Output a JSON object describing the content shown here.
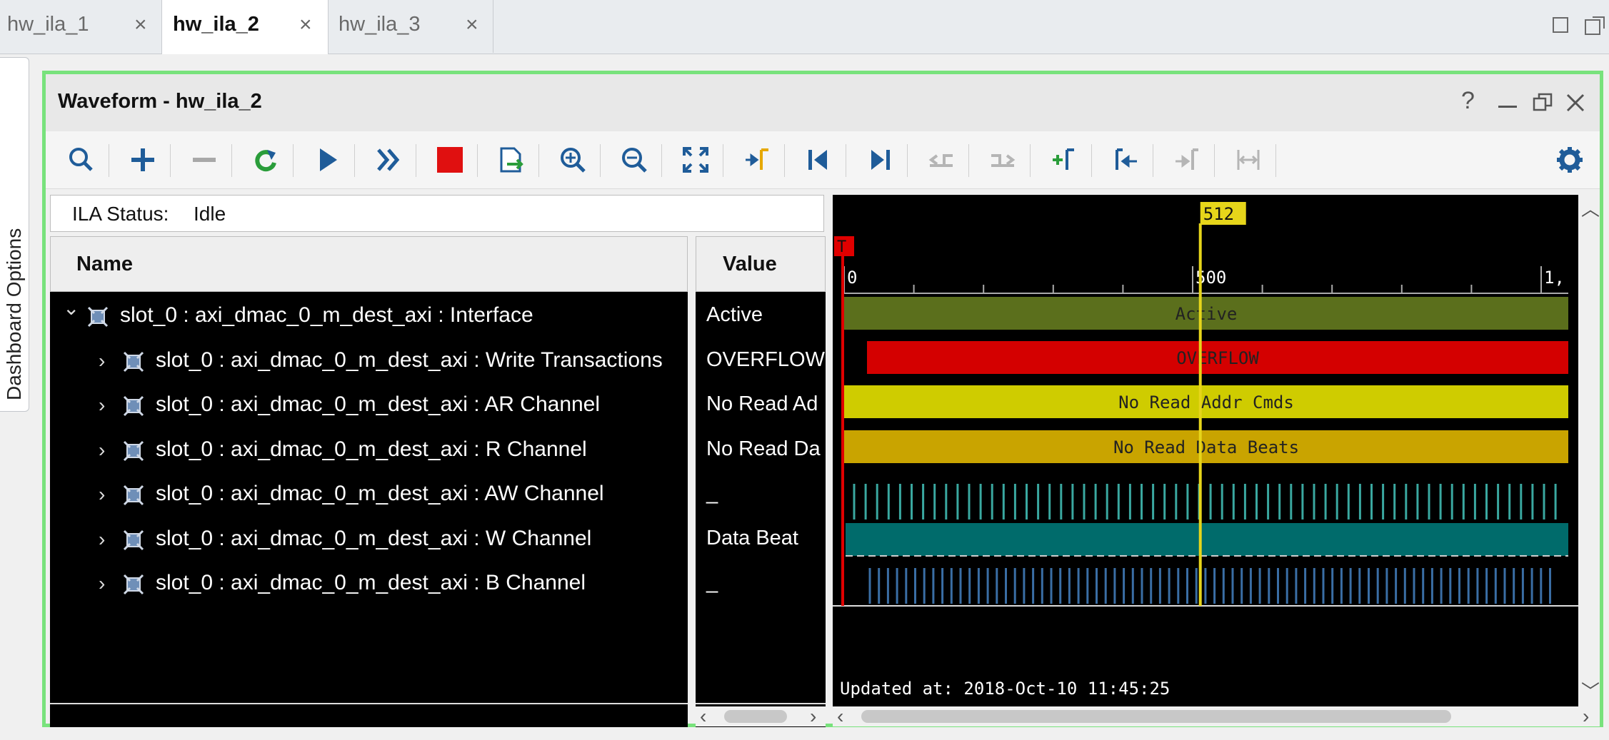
{
  "tabs": [
    {
      "label": "hw_ila_1",
      "active": false
    },
    {
      "label": "hw_ila_2",
      "active": true
    },
    {
      "label": "hw_ila_3",
      "active": false
    }
  ],
  "tab_close_glyph": "×",
  "side_tab": {
    "label": "Dashboard Options"
  },
  "window": {
    "title": "Waveform - hw_ila_2",
    "help_glyph": "?"
  },
  "toolbar": {
    "icons": [
      "search-icon",
      "add-icon",
      "remove-icon",
      "refresh-icon",
      "run-trigger-icon",
      "run-immediate-icon",
      "stop-icon",
      "export-icon",
      "zoom-in-icon",
      "zoom-out-icon",
      "zoom-fit-icon",
      "go-to-cursor-icon",
      "go-to-time-zero-icon",
      "go-to-last-time-icon",
      "previous-transition-icon",
      "next-transition-icon",
      "add-marker-icon",
      "previous-marker-icon",
      "next-marker-icon",
      "swap-cursors-icon",
      "settings-icon"
    ]
  },
  "status": {
    "label": "ILA Status:",
    "value": "Idle"
  },
  "columns": {
    "name": "Name",
    "value": "Value"
  },
  "signals": [
    {
      "name": "slot_0 : axi_dmac_0_m_dest_axi : Interface",
      "value": "Active",
      "expanded": true,
      "level": 0
    },
    {
      "name": "slot_0 : axi_dmac_0_m_dest_axi : Write Transactions",
      "value": "OVERFLOW",
      "expanded": false,
      "level": 1
    },
    {
      "name": "slot_0 : axi_dmac_0_m_dest_axi : AR Channel",
      "value": "No Read Ad",
      "expanded": false,
      "level": 1
    },
    {
      "name": "slot_0 : axi_dmac_0_m_dest_axi : R Channel",
      "value": "No Read Da",
      "expanded": false,
      "level": 1
    },
    {
      "name": "slot_0 : axi_dmac_0_m_dest_axi : AW Channel",
      "value": "_",
      "expanded": false,
      "level": 1
    },
    {
      "name": "slot_0 : axi_dmac_0_m_dest_axi : W Channel",
      "value": "Data Beat",
      "expanded": false,
      "level": 1
    },
    {
      "name": "slot_0 : axi_dmac_0_m_dest_axi : B Channel",
      "value": "_",
      "expanded": false,
      "level": 1
    }
  ],
  "waveform": {
    "cursor_label": "512",
    "trigger_label": "T",
    "ruler_labels": [
      "0",
      "500",
      "1,"
    ],
    "bars": [
      {
        "text": "Active",
        "color": "#5b6f1c"
      },
      {
        "text": "OVERFLOW",
        "color": "#d40000"
      },
      {
        "text": "No Read Addr Cmds",
        "color": "#cfcc00"
      },
      {
        "text": "No Read Data Beats",
        "color": "#c9a400"
      }
    ],
    "aw_color": "#3aa8a0",
    "w_color": "#006b6b",
    "b_color": "#3a6ea5",
    "trigger_color": "#e00000",
    "cursor_color": "#e6d51a",
    "updated": "Updated at: 2018-Oct-10 11:45:25"
  },
  "colors": {
    "panel_border": "#78e27c",
    "toolbar_blue": "#1f5c99",
    "stop_red": "#e01010",
    "refresh_green": "#2a9d3a"
  }
}
